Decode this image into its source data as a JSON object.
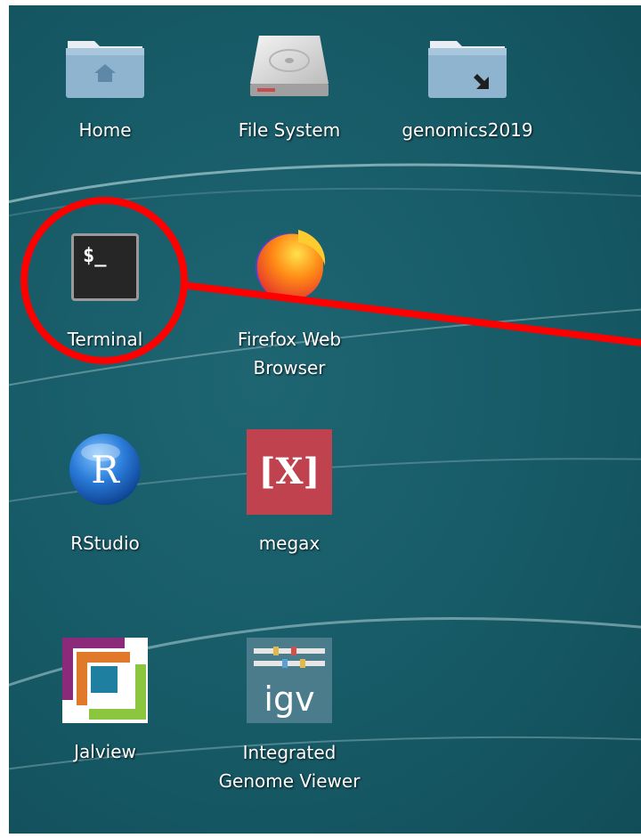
{
  "desktop": {
    "icons": [
      {
        "label": "Home",
        "icon": "home-folder-icon"
      },
      {
        "label": "File System",
        "icon": "hard-drive-icon"
      },
      {
        "label": "genomics2019",
        "icon": "folder-link-icon"
      },
      {
        "label": "Terminal",
        "icon": "terminal-icon",
        "glyph_text": "$_"
      },
      {
        "label": "Firefox Web\nBrowser",
        "icon": "firefox-icon"
      },
      {
        "label": "RStudio",
        "icon": "r-logo-icon",
        "glyph_text": "R"
      },
      {
        "label": "megax",
        "icon": "megax-icon",
        "glyph_text": "[X]"
      },
      {
        "label": "Jalview",
        "icon": "jalview-icon"
      },
      {
        "label": "Integrated\nGenome Viewer",
        "icon": "igv-icon",
        "glyph_text": "igv"
      }
    ]
  },
  "annotation": {
    "highlight": "terminal-icon",
    "color": "#ff0000"
  },
  "colors": {
    "desktop_bg": "#165a66",
    "label_text": "#ffffff"
  }
}
